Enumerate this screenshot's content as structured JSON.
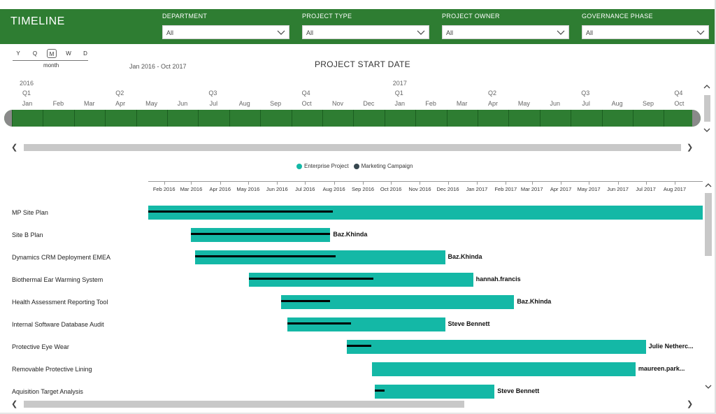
{
  "header": {
    "title": "TIMELINE",
    "color": "#2e7d32",
    "filters": [
      {
        "label": "DEPARTMENT",
        "value": "All"
      },
      {
        "label": "PROJECT TYPE",
        "value": "All"
      },
      {
        "label": "PROJECT OWNER",
        "value": "All"
      },
      {
        "label": "GOVERNANCE PHASE",
        "value": "All"
      }
    ]
  },
  "granularity": {
    "options": [
      "Y",
      "Q",
      "M",
      "W",
      "D"
    ],
    "selected": "M",
    "caption": "month"
  },
  "date_range": "Jan 2016 - Oct 2017",
  "panel_title": "PROJECT START DATE",
  "timeline_slicer": {
    "years": [
      "2016",
      "2017"
    ],
    "quarters": [
      "Q1",
      "Q2",
      "Q3",
      "Q4",
      "Q1",
      "Q2",
      "Q3",
      "Q4"
    ],
    "months": [
      "Jan",
      "Feb",
      "Mar",
      "Apr",
      "May",
      "Jun",
      "Jul",
      "Aug",
      "Sep",
      "Oct",
      "Nov",
      "Dec",
      "Jan",
      "Feb",
      "Mar",
      "Apr",
      "May",
      "Jun",
      "Jul",
      "Aug",
      "Sep",
      "Oct"
    ]
  },
  "legend": [
    {
      "label": "Enterprise Project",
      "color": "#14b8a6"
    },
    {
      "label": "Marketing Campaign",
      "color": "#37474f"
    }
  ],
  "chart_data": {
    "type": "gantt",
    "x_axis_ticks": [
      "Feb 2016",
      "Mar 2016",
      "Apr 2016",
      "May 2016",
      "Jun 2016",
      "Jul 2016",
      "Aug 2016",
      "Sep 2016",
      "Oct 2016",
      "Nov 2016",
      "Dec 2016",
      "Jan 2017",
      "Feb 2017",
      "Mar 2017",
      "Apr 2017",
      "May 2017",
      "Jun 2017",
      "Jul 2017",
      "Aug 2017"
    ],
    "x_range": [
      "2016-01-15",
      "2017-08-31"
    ],
    "series": "Enterprise Project",
    "tasks": [
      {
        "name": "MP Site Plan",
        "start": "2016-01-15",
        "end": "2017-08-31",
        "progress_end": "2016-07-31",
        "owner": ""
      },
      {
        "name": "Site B Plan",
        "start": "2016-03-01",
        "end": "2016-07-28",
        "progress_end": "2016-07-28",
        "owner": "Baz.Khinda"
      },
      {
        "name": "Dynamics CRM Deployment EMEA",
        "start": "2016-03-05",
        "end": "2016-11-28",
        "progress_end": "2016-08-03",
        "owner": "Baz.Khinda"
      },
      {
        "name": "Biothermal Ear Warming System",
        "start": "2016-05-02",
        "end": "2016-12-28",
        "progress_end": "2016-09-12",
        "owner": "hannah.francis"
      },
      {
        "name": "Health Assessment Reporting Tool",
        "start": "2016-06-05",
        "end": "2017-02-10",
        "progress_end": "2016-07-28",
        "owner": "Baz.Khinda"
      },
      {
        "name": "Internal Software Database Audit",
        "start": "2016-06-12",
        "end": "2016-11-28",
        "progress_end": "2016-08-19",
        "owner": "Steve Bennett"
      },
      {
        "name": "Protective Eye Wear",
        "start": "2016-08-15",
        "end": "2017-07-01",
        "progress_end": "2016-09-10",
        "owner": "Julie Netherc..."
      },
      {
        "name": "Removable Protective Lining",
        "start": "2016-09-11",
        "end": "2017-06-20",
        "progress_end": "",
        "owner": "maureen.park..."
      },
      {
        "name": "Aquisition Target Analysis",
        "start": "2016-09-14",
        "end": "2017-01-20",
        "progress_end": "2016-09-24",
        "owner": "Steve Bennett"
      }
    ]
  }
}
